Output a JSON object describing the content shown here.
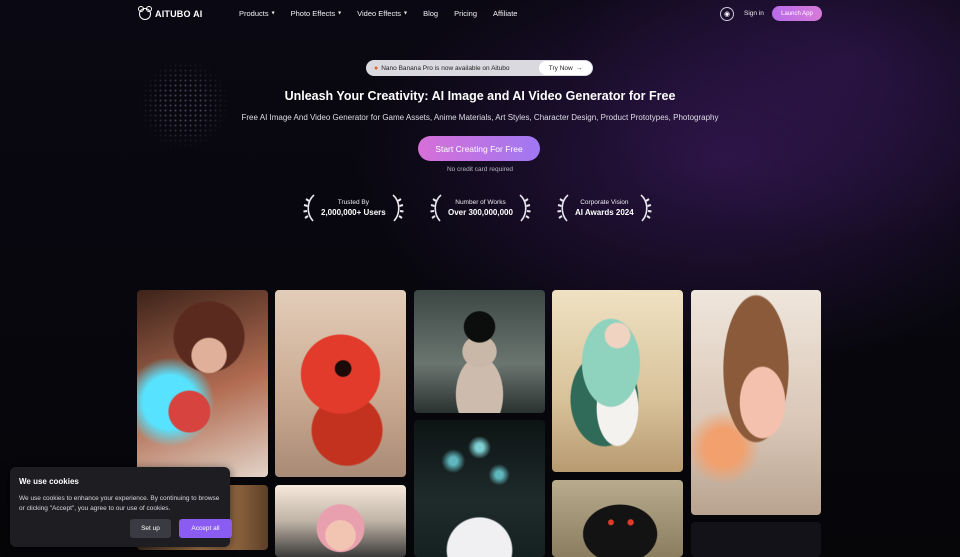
{
  "nav": {
    "logo_text": "AITUBO AI",
    "menu": [
      {
        "label": "Products",
        "dropdown": true
      },
      {
        "label": "Photo Effects",
        "dropdown": true
      },
      {
        "label": "Video Effects",
        "dropdown": true
      },
      {
        "label": "Blog",
        "dropdown": false
      },
      {
        "label": "Pricing",
        "dropdown": false
      },
      {
        "label": "Affiliate",
        "dropdown": false
      }
    ],
    "signin_label": "Sign in",
    "launch_label": "Launch App"
  },
  "announcement": {
    "text": "Nano Banana Pro is now available on Aitubo",
    "try_label": "Try Now"
  },
  "hero": {
    "headline": "Unleash Your Creativity: AI Image and AI Video Generator for Free",
    "subline": "Free AI Image And Video Generator for Game Assets, Anime Materials, Art Styles, Character Design, Product Prototypes, Photography",
    "cta_label": "Start Creating For Free",
    "note": "No credit card required"
  },
  "awards": [
    {
      "label": "Trusted By",
      "value": "2,000,000+ Users"
    },
    {
      "label": "Number of Works",
      "value": "Over 300,000,000"
    },
    {
      "label": "Corporate Vision",
      "value": "AI Awards 2024"
    }
  ],
  "cookie": {
    "title": "We use cookies",
    "text": "We use cookies to enhance your experience. By continuing to browse or clicking \"Accept\", you agree to our use of cookies.",
    "setup_label": "Set up",
    "accept_label": "Accept all"
  },
  "colors": {
    "accent": "#8a5cf2",
    "cta_gradient_start": "#d76fd8",
    "cta_gradient_end": "#9f78f2",
    "background": "#07070c"
  }
}
